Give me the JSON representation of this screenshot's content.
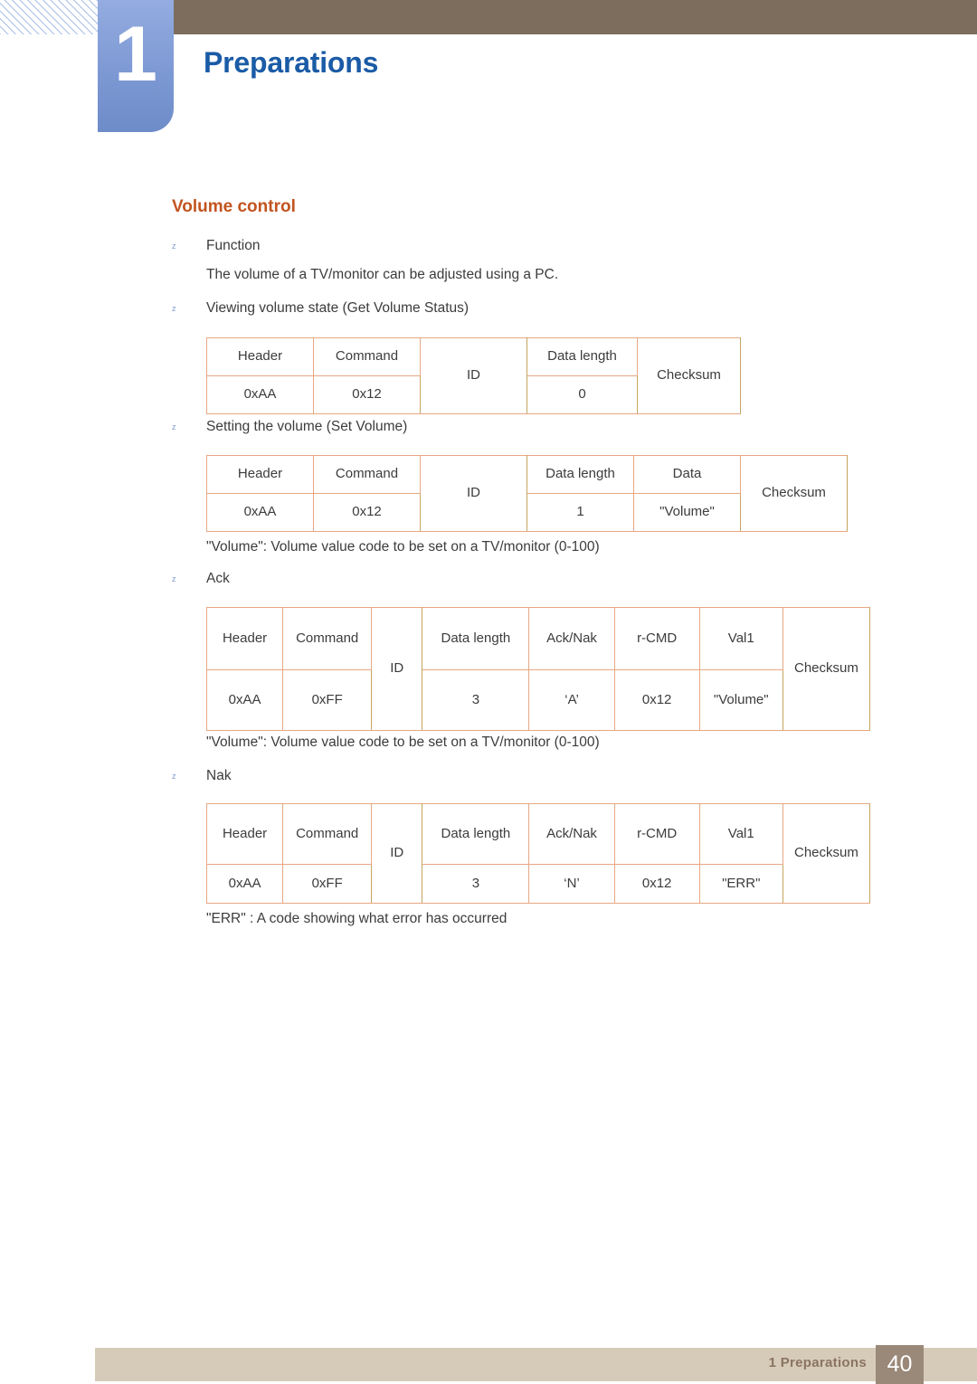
{
  "header": {
    "chapter_number": "1",
    "chapter_title": "Preparations"
  },
  "section": {
    "title": "Volume control"
  },
  "bullet_glyph": "z",
  "blocks": [
    {
      "type": "bullet",
      "text": "Function"
    },
    {
      "type": "plain",
      "text": "The volume of a TV/monitor can be adjusted using a PC."
    },
    {
      "type": "bullet",
      "text": "Viewing volume state (Get Volume Status)"
    },
    {
      "type": "bullet",
      "text": "Setting the volume (Set Volume)"
    },
    {
      "type": "plain",
      "text": "\"Volume\": Volume value code to be set on a TV/monitor (0-100)"
    },
    {
      "type": "bullet",
      "text": "Ack"
    },
    {
      "type": "plain",
      "text": "\"Volume\": Volume value code to be set on a TV/monitor (0-100)"
    },
    {
      "type": "bullet",
      "text": "Nak"
    },
    {
      "type": "plain",
      "text": "\"ERR\" : A code showing what error has occurred"
    }
  ],
  "tables": {
    "get_volume_status": {
      "name": "Viewing volume state (Get Volume Status)",
      "headers": [
        "Header",
        "Command",
        "ID",
        "Data length",
        "Checksum"
      ],
      "values": [
        "0xAA",
        "0x12",
        "",
        "0",
        ""
      ]
    },
    "set_volume": {
      "name": "Setting the volume (Set Volume)",
      "headers": [
        "Header",
        "Command",
        "ID",
        "Data length",
        "Data",
        "Checksum"
      ],
      "values": [
        "0xAA",
        "0x12",
        "",
        "1",
        "\"Volume\"",
        ""
      ]
    },
    "ack": {
      "name": "Ack",
      "headers": [
        "Header",
        "Command",
        "ID",
        "Data length",
        "Ack/Nak",
        "r-CMD",
        "Val1",
        "Checksum"
      ],
      "values": [
        "0xAA",
        "0xFF",
        "",
        "3",
        "‘A’",
        "0x12",
        "\"Volume\"",
        ""
      ]
    },
    "nak": {
      "name": "Nak",
      "headers": [
        "Header",
        "Command",
        "ID",
        "Data length",
        "Ack/Nak",
        "r-CMD",
        "Val1",
        "Checksum"
      ],
      "values": [
        "0xAA",
        "0xFF",
        "",
        "3",
        "‘N’",
        "0x12",
        "\"ERR\"",
        ""
      ]
    }
  },
  "footer": {
    "label": "1 Preparations",
    "page_number": "40"
  },
  "colors": {
    "chapter_tab": "#7d99d4",
    "header_bar": "#7d6d5d",
    "chapter_title": "#1a5ba6",
    "section_title": "#c2541f",
    "table_outer_border": "#9a8158",
    "table_inner_border": "#e8a784",
    "footer_bar": "#d6cbb8",
    "footer_page_box": "#9a8878",
    "bullet": "#7e9ad0"
  }
}
